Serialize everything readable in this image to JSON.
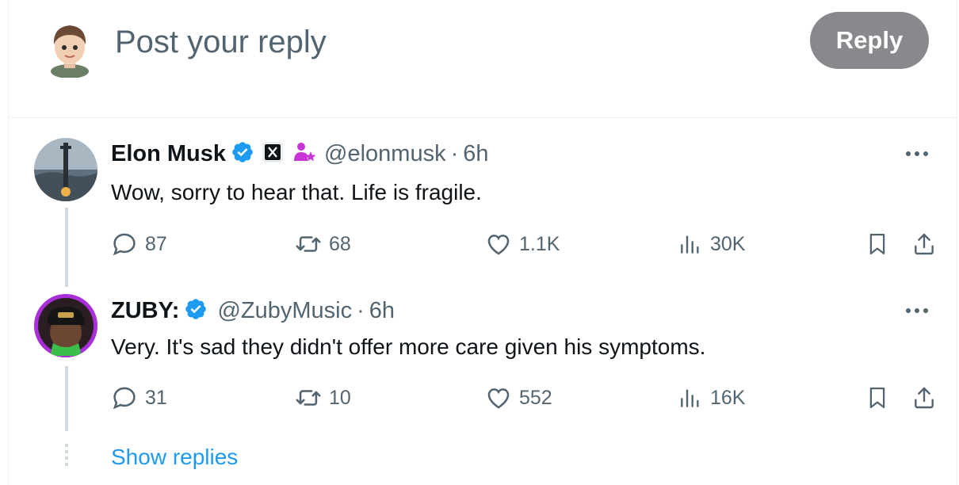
{
  "compose": {
    "placeholder": "Post your reply",
    "reply_button": "Reply"
  },
  "tweets": [
    {
      "name": "Elon Musk",
      "handle": "@elonmusk",
      "separator": "·",
      "time": "6h",
      "text": "Wow, sorry to hear that. Life is fragile.",
      "replies": "87",
      "reposts": "68",
      "likes": "1.1K",
      "views": "30K",
      "badges": [
        "verified-icon",
        "x-affiliate-icon",
        "subscriber-icon"
      ]
    },
    {
      "name": "ZUBY:",
      "handle": "@ZubyMusic",
      "separator": "·",
      "time": "6h",
      "text": "Very. It's sad they didn't offer more care given his symptoms.",
      "replies": "31",
      "reposts": "10",
      "likes": "552",
      "views": "16K",
      "badges": [
        "verified-icon"
      ]
    }
  ],
  "show_replies": "Show replies",
  "colors": {
    "accent": "#1d9bf0",
    "secondary_text": "#536471",
    "reply_button_bg": "#87898c",
    "subscriber_badge": "#c934d6"
  }
}
